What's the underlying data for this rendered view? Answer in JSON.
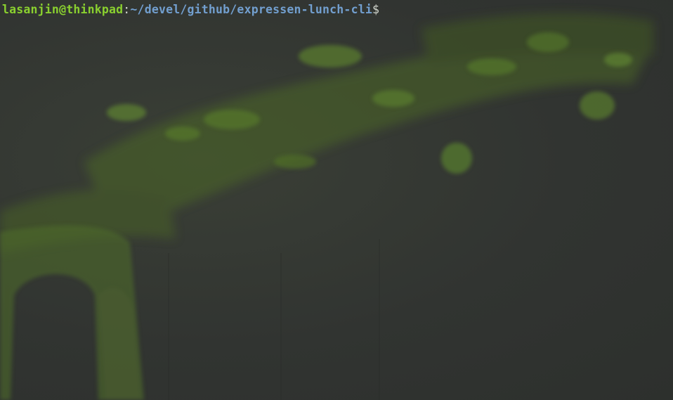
{
  "terminal": {
    "prompt": {
      "user_host": "lasanjin@thinkpad",
      "separator": ":",
      "path": "~/devel/github/expressen-lunch-cli",
      "symbol": "$"
    }
  },
  "colors": {
    "background": "#323532",
    "user_host": "#8ad02f",
    "path": "#729fcf",
    "text": "#d3d7cf",
    "wallpaper_accent": "#5a7a2e"
  },
  "icons": {
    "wallpaper": "dark-green-abstract-wallpaper"
  }
}
